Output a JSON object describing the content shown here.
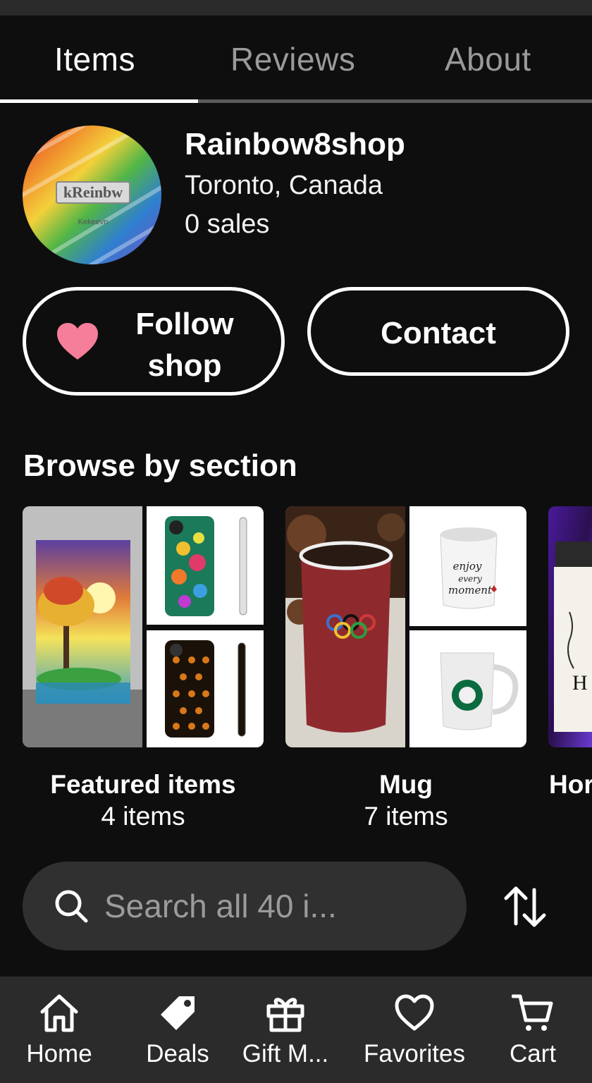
{
  "tabs": [
    {
      "label": "Items",
      "active": true
    },
    {
      "label": "Reviews",
      "active": false
    },
    {
      "label": "About",
      "active": false
    }
  ],
  "shop": {
    "avatar_text": "kReinbw",
    "avatar_subtext": "Kekeevn",
    "name": "Rainbow8shop",
    "location": "Toronto, Canada",
    "sales": "0 sales"
  },
  "buttons": {
    "follow_line1": "Follow",
    "follow_line2": "shop",
    "contact": "Contact"
  },
  "browse": {
    "title": "Browse by section",
    "sections": [
      {
        "title": "Featured items",
        "count": "4 items"
      },
      {
        "title": "Mug",
        "count": "7 items"
      },
      {
        "title": "Hor",
        "count": ""
      }
    ]
  },
  "search": {
    "placeholder": "Search all 40 i..."
  },
  "nav": [
    {
      "label": "Home",
      "icon": "home-icon"
    },
    {
      "label": "Deals",
      "icon": "tag-icon"
    },
    {
      "label": "Gift M...",
      "icon": "gift-icon"
    },
    {
      "label": "Favorites",
      "icon": "heart-outline-icon"
    },
    {
      "label": "Cart",
      "icon": "cart-icon"
    }
  ],
  "colors": {
    "background": "#0e0e0e",
    "heart": "#f57e9a",
    "search_bg": "#303030",
    "nav_bg": "#2b2b2b"
  }
}
